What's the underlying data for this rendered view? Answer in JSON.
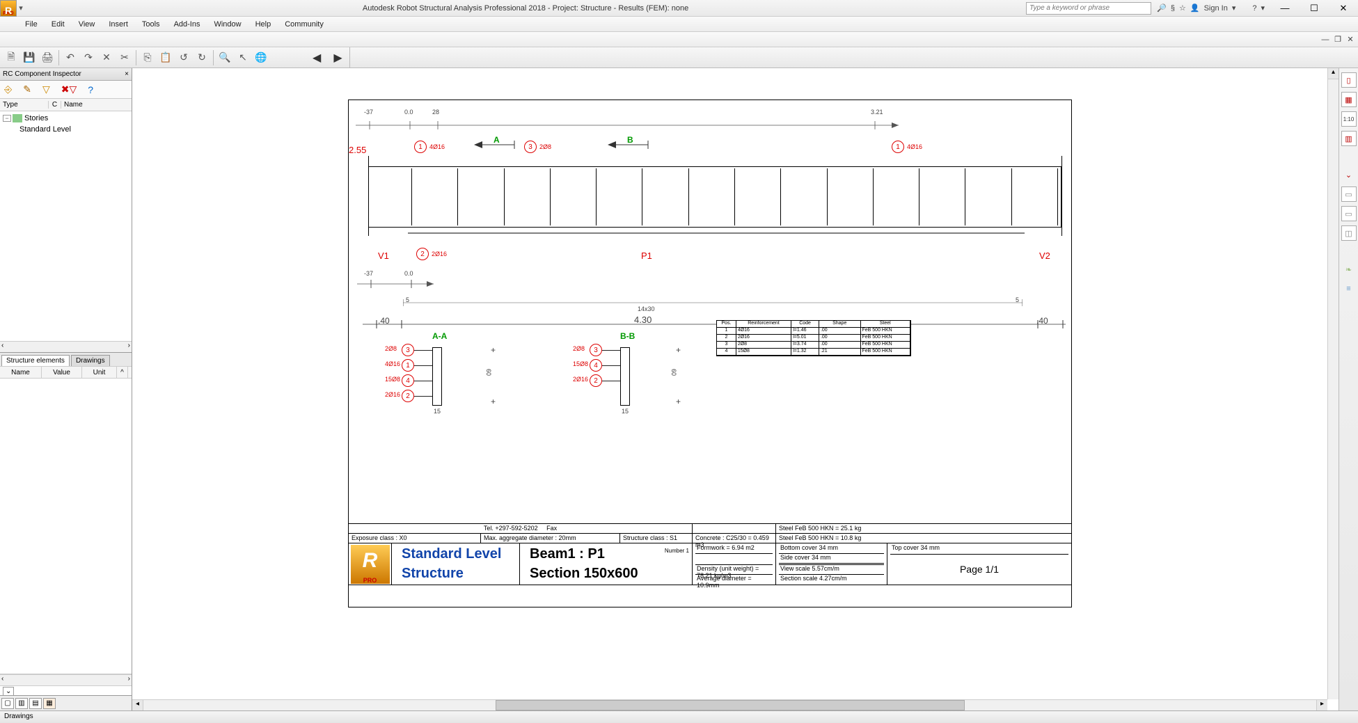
{
  "title": "Autodesk Robot Structural Analysis Professional 2018 - Project: Structure - Results (FEM): none",
  "search_placeholder": "Type a keyword or phrase",
  "signin": "Sign In",
  "menu": [
    "File",
    "Edit",
    "View",
    "Insert",
    "Tools",
    "Add-Ins",
    "Window",
    "Help",
    "Community"
  ],
  "panel_title": "RC Component Inspector",
  "tree_hdr": {
    "c1": "Type",
    "c2": "C",
    "c3": "Name"
  },
  "tree": {
    "root": "Stories",
    "child": "Standard Level"
  },
  "lp_tabs": [
    "Structure elements",
    "Drawings"
  ],
  "grid_hdr": [
    "Name",
    "Value",
    "Unit"
  ],
  "status": "Drawings",
  "drawing": {
    "top_dims": [
      "-37",
      "0.0",
      "28",
      "3.21"
    ],
    "section_marks": [
      "A",
      "B"
    ],
    "elev_h": "2.55",
    "bars_top": [
      {
        "n": "1",
        "spec": "4Ø16"
      },
      {
        "n": "3",
        "spec": "2Ø8"
      },
      {
        "n": "1",
        "spec": "4Ø16"
      }
    ],
    "bottom_bar": {
      "n": "2",
      "spec": "2Ø16"
    },
    "supports": [
      "V1",
      "P1",
      "V2"
    ],
    "mid_dims_top": [
      "-37",
      "0.0"
    ],
    "mid_dims_low": [
      "5",
      "14x30",
      "5"
    ],
    "span_dims": [
      ".40",
      "4.30",
      ".40"
    ],
    "sections": {
      "A": {
        "title": "A-A",
        "rows": [
          {
            "n": "3",
            "spec": "2Ø8"
          },
          {
            "n": "1",
            "spec": "4Ø16"
          },
          {
            "n": "4",
            "spec": "15Ø8"
          },
          {
            "n": "2",
            "spec": "2Ø16"
          }
        ],
        "h": "60",
        "b": "15"
      },
      "B": {
        "title": "B-B",
        "rows": [
          {
            "n": "3",
            "spec": "2Ø8"
          },
          {
            "n": "4",
            "spec": "15Ø8"
          },
          {
            "n": "2",
            "spec": "2Ø16"
          }
        ],
        "h": "60",
        "b": "15"
      }
    },
    "schedule": {
      "hdr": [
        "Pos.",
        "Reinforcement",
        "Code",
        "Shape",
        "Steel"
      ],
      "rows": [
        [
          "1",
          "4Ø16",
          "l=1.46",
          ".00",
          "FeB 500 HKN"
        ],
        [
          "2",
          "2Ø16",
          "l=5.01",
          ".00",
          "FeB 500 HKN"
        ],
        [
          "3",
          "2Ø8",
          "l=3.74",
          ".00",
          "FeB 500 HKN"
        ],
        [
          "4",
          "15Ø8",
          "l=1.32",
          ".21",
          "FeB 500 HKN"
        ]
      ]
    }
  },
  "titleblock": {
    "tel": "Tel. +297-592-5202",
    "fax": "Fax",
    "exposure": "Exposure class : X0",
    "aggregate": "Max. aggregate diameter : 20mm",
    "structclass": "Structure class : S1",
    "concrete": "Concrete : C25/30 = 0.459 m3",
    "formwork": "Formwork = 6.94 m2",
    "density": "Density (unit weight) = 78.21 kg/m3",
    "avgdia": "Average diameter = 10.9mm",
    "steel1": "Steel FeB 500 HKN = 25.1 kg",
    "steel2": "Steel FeB 500 HKN = 10.8 kg",
    "botcover": "Bottom cover 34 mm",
    "topcover": "Top cover 34 mm",
    "sidecover": "Side cover 34 mm",
    "viewscale": "View scale 5.57cm/m",
    "sectionscale": "Section scale 4.27cm/m",
    "level": "Standard Level",
    "struct": "Structure",
    "beam": "Beam1 : P1",
    "section": "Section 150x600",
    "number": "Number 1",
    "page": "Page 1/1",
    "logo_pro": "PRO"
  }
}
